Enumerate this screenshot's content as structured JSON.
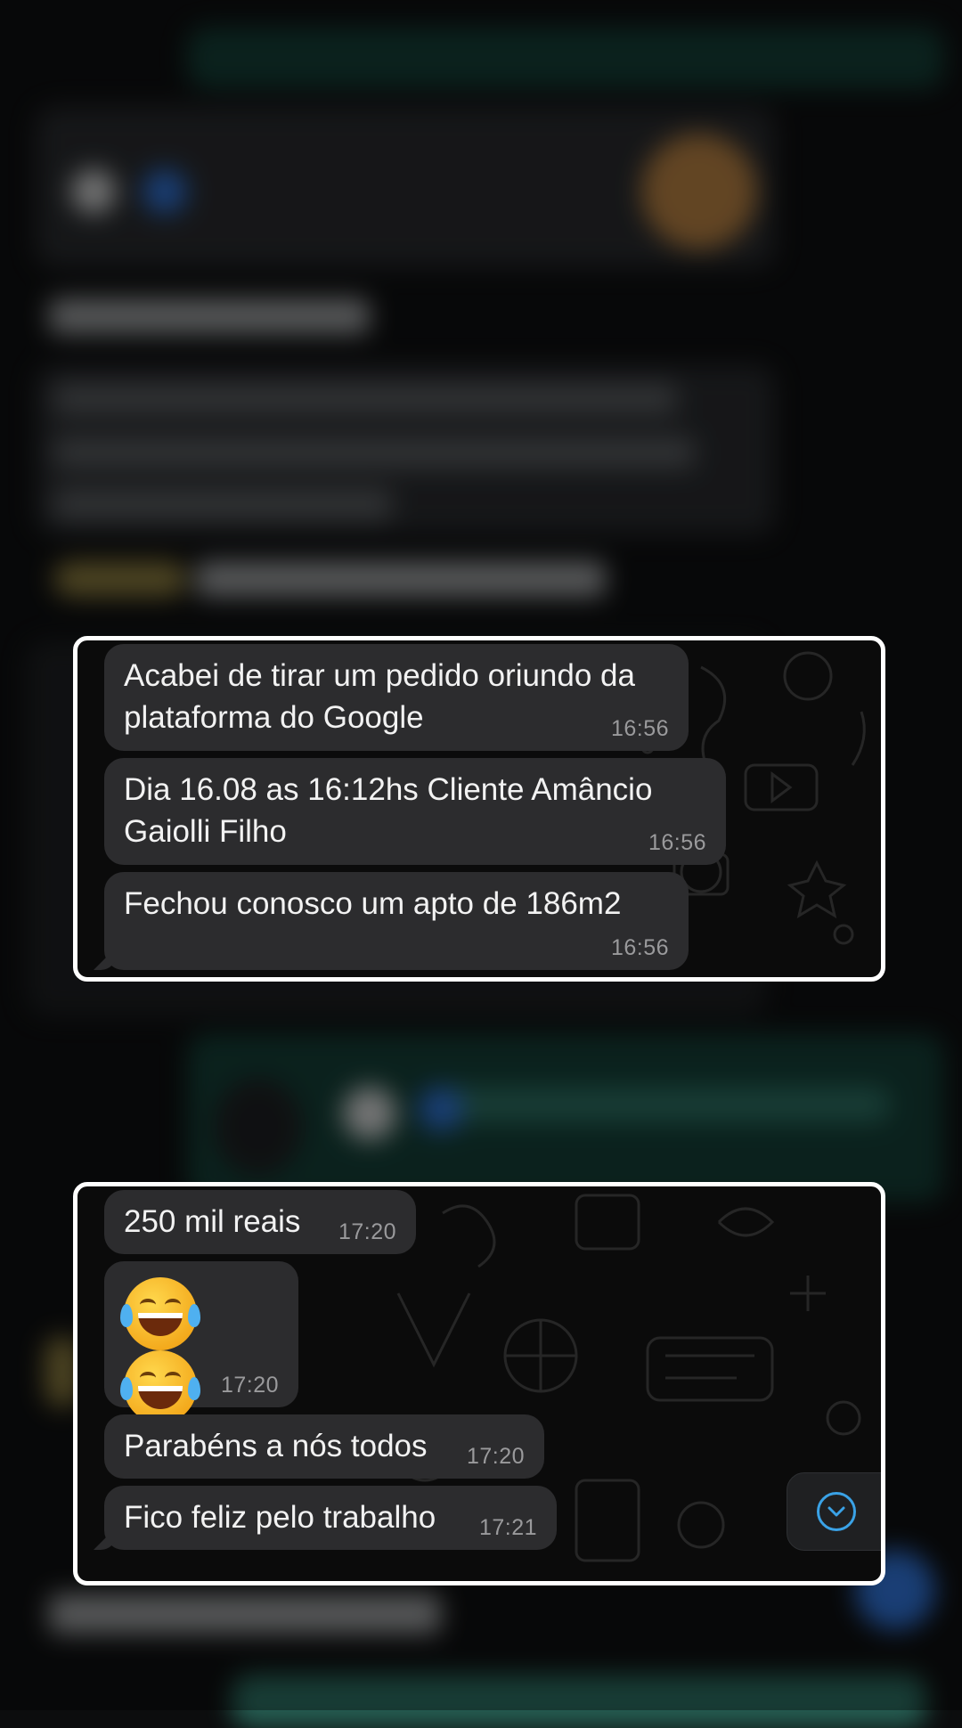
{
  "colors": {
    "bubble_incoming": "#2c2c2e",
    "bubble_text": "#f2f2f2",
    "timestamp": "#9a9a9c",
    "highlight_border": "#ffffff",
    "scroll_button_accent": "#3aa2e6",
    "outgoing_bubble": "#123b33"
  },
  "highlight_groups": [
    {
      "messages": [
        {
          "text": "Acabei de tirar um pedido oriundo da plataforma do Google",
          "time": "16:56"
        },
        {
          "text": "Dia 16.08 as 16:12hs Cliente Amâncio Gaiolli Filho",
          "time": "16:56"
        },
        {
          "text": "Fechou conosco um apto de 186m2",
          "time": "16:56"
        }
      ]
    },
    {
      "messages": [
        {
          "text": "250 mil reais",
          "time": "17:20"
        },
        {
          "text": "😂😂",
          "time": "17:20",
          "emoji_icons": [
            "tears-of-joy-icon",
            "tears-of-joy-icon"
          ]
        },
        {
          "text": "Parabéns a nós todos",
          "time": "17:20"
        },
        {
          "text": "Fico feliz pelo trabalho",
          "time": "17:21"
        }
      ]
    }
  ],
  "scroll_button": {
    "icon": "chevron-down-icon"
  }
}
